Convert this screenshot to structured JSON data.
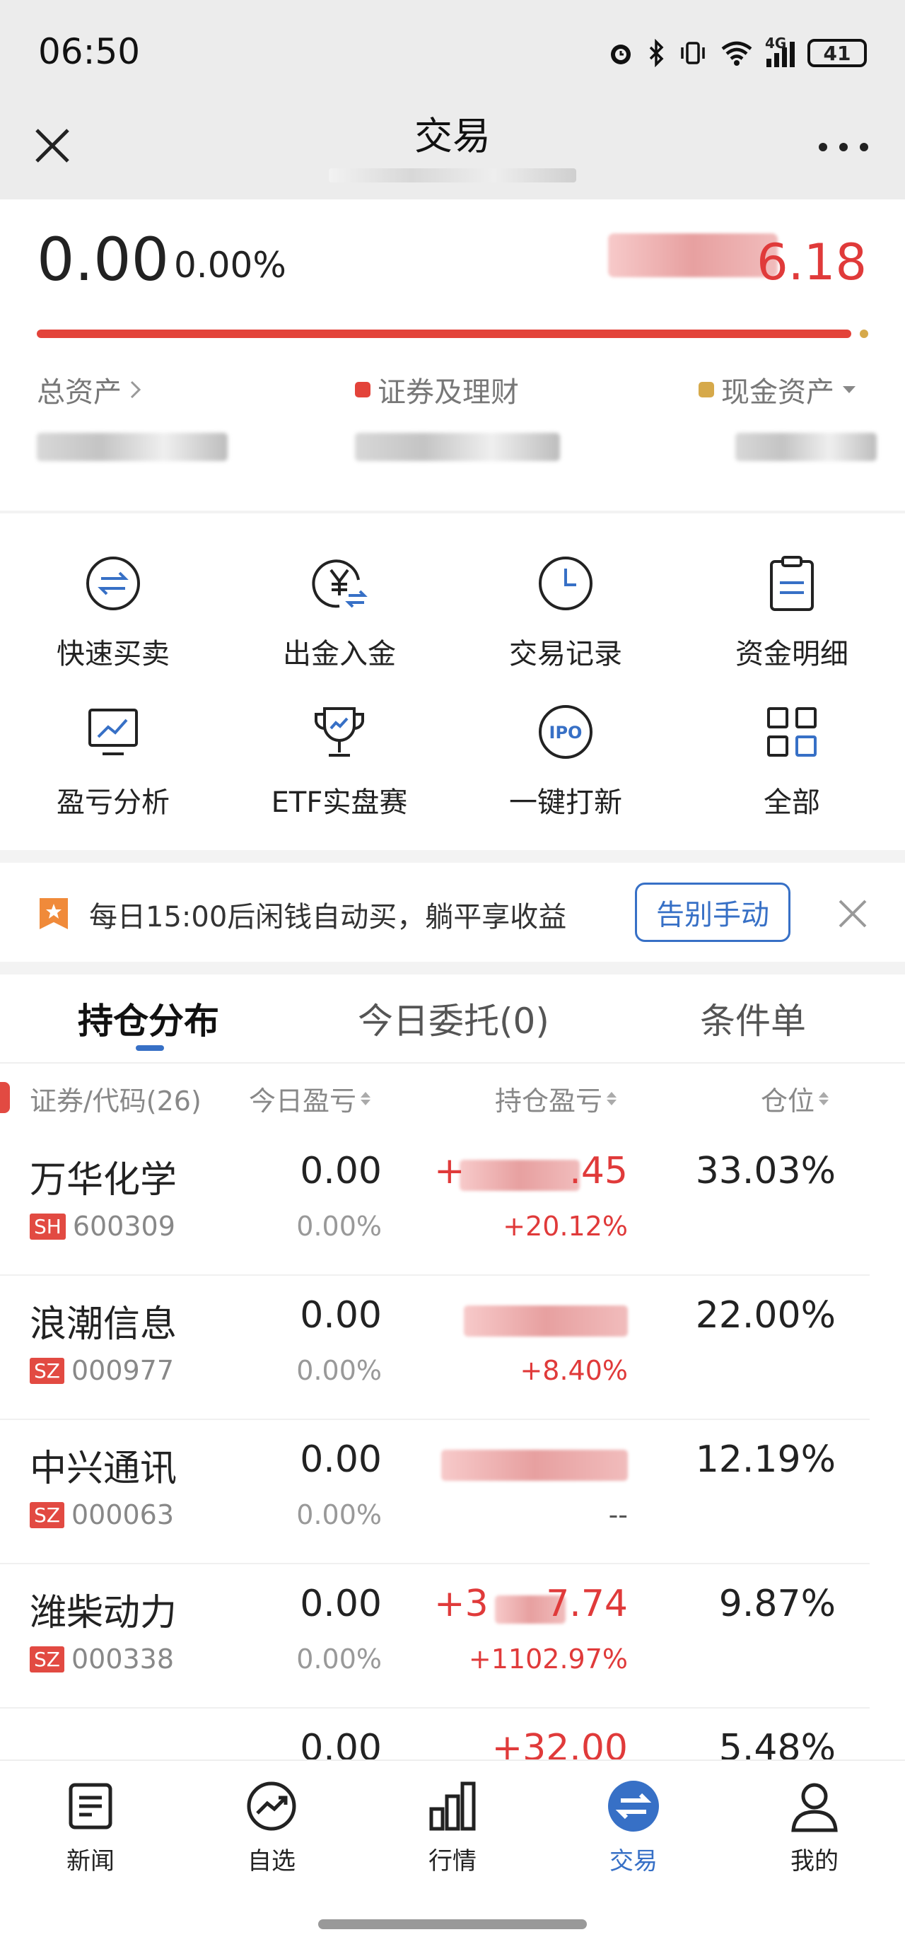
{
  "status_bar": {
    "time": "06:50",
    "battery": "41",
    "network": "4G"
  },
  "header": {
    "title": "交易"
  },
  "summary": {
    "today_pnl": "0.00",
    "today_pnl_pct": "0.00%",
    "holding_pnl_visible": "6.18",
    "securities_ratio": 0.99
  },
  "assets": {
    "total_label": "总资产",
    "securities_label": "证券及理财",
    "cash_label": "现金资产",
    "securities_color": "#e3433a",
    "cash_color": "#d6a94a"
  },
  "tools": [
    {
      "label": "快速买卖",
      "icon": "swap-circle-icon"
    },
    {
      "label": "出金入金",
      "icon": "yuan-transfer-icon"
    },
    {
      "label": "交易记录",
      "icon": "clock-icon"
    },
    {
      "label": "资金明细",
      "icon": "clipboard-icon"
    },
    {
      "label": "盈亏分析",
      "icon": "monitor-chart-icon"
    },
    {
      "label": "ETF实盘赛",
      "icon": "trophy-icon"
    },
    {
      "label": "一键打新",
      "icon": "ipo-icon"
    },
    {
      "label": "全部",
      "icon": "grid-icon"
    }
  ],
  "banner": {
    "text": "每日15:00后闲钱自动买，躺平享收益",
    "button": "告别手动"
  },
  "tabs": {
    "holdings": "持仓分布",
    "orders": "今日委托(0)",
    "conditional": "条件单"
  },
  "table": {
    "col_security": "证券/代码(26)",
    "col_day": "今日盈亏",
    "col_hold": "持仓盈亏",
    "col_position": "仓位",
    "rows": [
      {
        "name": "万华化学",
        "market": "SH",
        "code": "600309",
        "day": "0.00",
        "day_pct": "0.00%",
        "hold": "+",
        "hold_tail": ".45",
        "hold_pct": "+20.12%",
        "position": "33.03%"
      },
      {
        "name": "浪潮信息",
        "market": "SZ",
        "code": "000977",
        "day": "0.00",
        "day_pct": "0.00%",
        "hold": "",
        "hold_tail": "",
        "hold_pct": "+8.40%",
        "position": "22.00%"
      },
      {
        "name": "中兴通讯",
        "market": "SZ",
        "code": "000063",
        "day": "0.00",
        "day_pct": "0.00%",
        "hold": "",
        "hold_tail": "",
        "hold_pct": "--",
        "position": "12.19%"
      },
      {
        "name": "潍柴动力",
        "market": "SZ",
        "code": "000338",
        "day": "0.00",
        "day_pct": "0.00%",
        "hold": "+3",
        "hold_tail": "7.74",
        "hold_pct": "+1102.97%",
        "position": "9.87%"
      },
      {
        "name": "",
        "market": "",
        "code": "",
        "day": "0.00",
        "day_pct": "",
        "hold": "+32.00",
        "hold_tail": "",
        "hold_pct": "",
        "position": "5.48%"
      }
    ]
  },
  "bottom_nav": [
    {
      "label": "新闻",
      "icon": "news-icon"
    },
    {
      "label": "自选",
      "icon": "trend-icon"
    },
    {
      "label": "行情",
      "icon": "bars-icon"
    },
    {
      "label": "交易",
      "icon": "exchange-icon",
      "active": true
    },
    {
      "label": "我的",
      "icon": "user-icon"
    }
  ],
  "colors": {
    "accent": "#3770c6",
    "up": "#e03a3a",
    "tag": "#e24a42"
  }
}
